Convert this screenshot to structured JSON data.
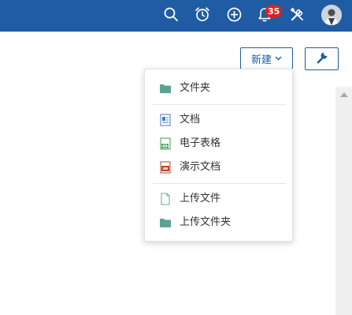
{
  "topbar": {
    "icons": [
      "search-icon",
      "alarm-clock-icon",
      "add-circle-icon",
      "bell-icon",
      "tools-icon"
    ],
    "notification_count": "35",
    "accent_color": "#1f5ca3"
  },
  "toolbar": {
    "new_label": "新建",
    "new_chevron": "⌄",
    "tool_icon": "wrench-icon"
  },
  "dropdown": {
    "items": [
      {
        "label": "文件夹",
        "icon": "folder-icon"
      },
      {
        "label": "文档",
        "icon": "document-icon"
      },
      {
        "label": "电子表格",
        "icon": "spreadsheet-icon"
      },
      {
        "label": "演示文档",
        "icon": "presentation-icon"
      },
      {
        "label": "上传文件",
        "icon": "upload-file-icon"
      },
      {
        "label": "上传文件夹",
        "icon": "upload-folder-icon"
      }
    ]
  }
}
